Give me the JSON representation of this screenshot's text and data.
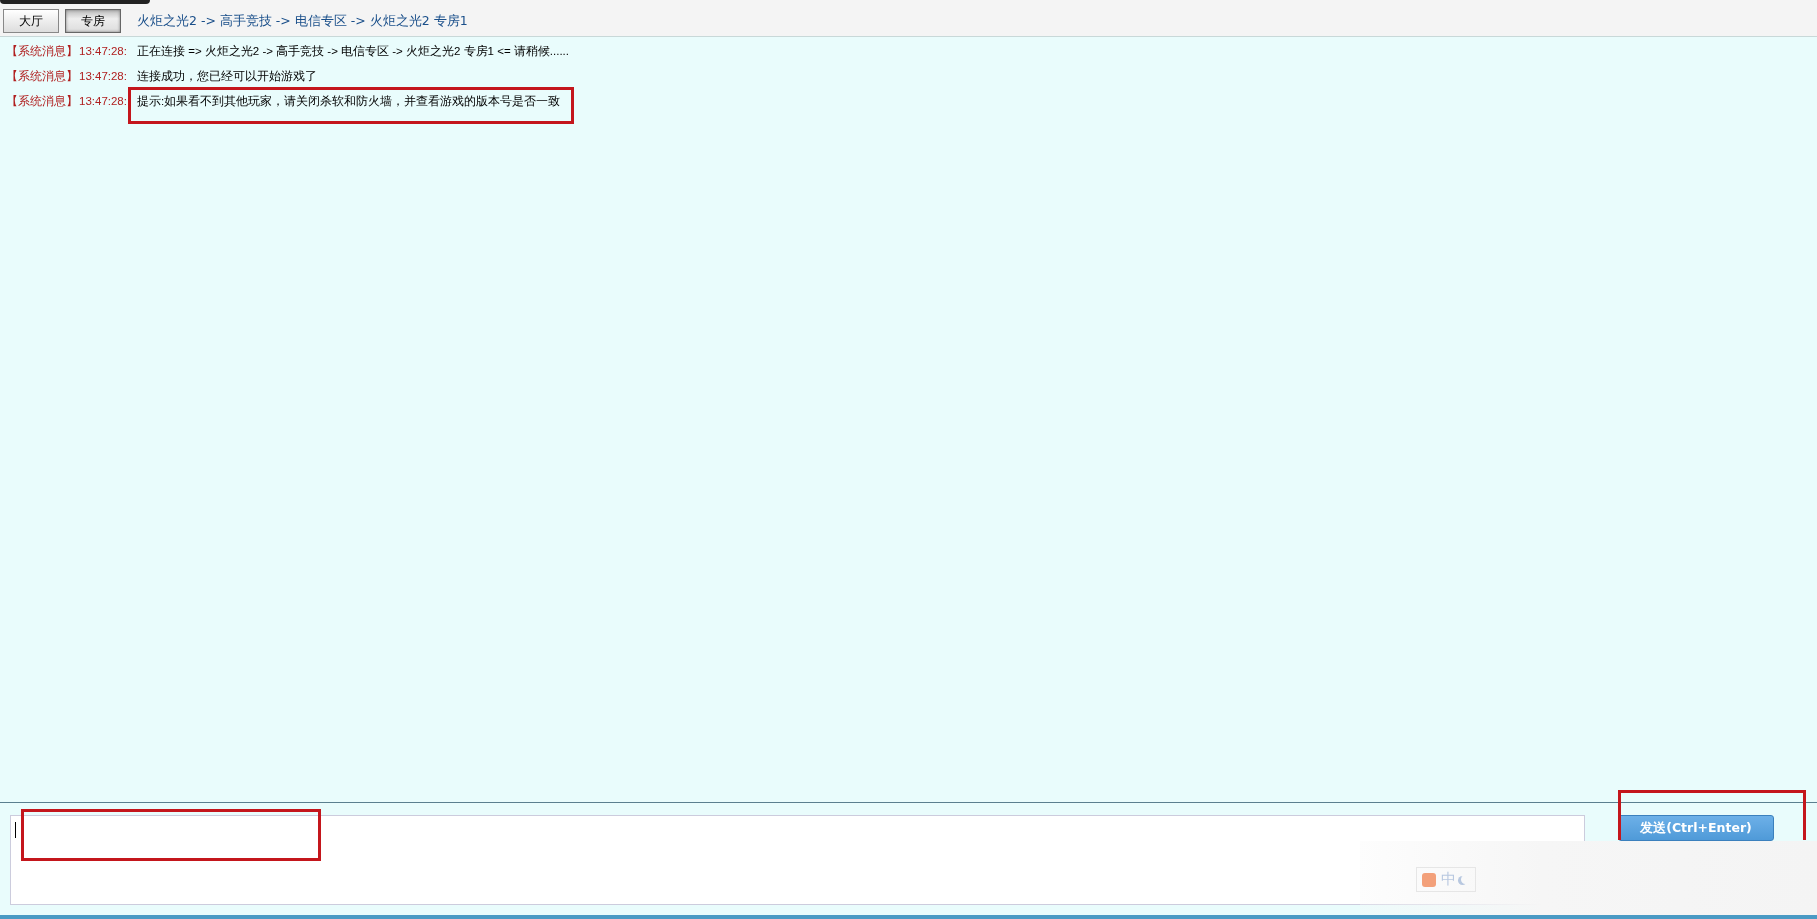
{
  "tabs": [
    {
      "label": "大厅",
      "selected": false
    },
    {
      "label": "专房",
      "selected": true
    }
  ],
  "breadcrumb": "火炬之光2 -> 高手竞技 -> 电信专区 -> 火炬之光2 专房1",
  "messages": [
    {
      "source": "【系统消息】",
      "time": "13:47:28:",
      "text": "正在连接 => 火炬之光2 -> 高手竞技 -> 电信专区 -> 火炬之光2 专房1 <= 请稍候......"
    },
    {
      "source": "【系统消息】",
      "time": "13:47:28:",
      "text": "连接成功，您已经可以开始游戏了"
    },
    {
      "source": "【系统消息】",
      "time": "13:47:28:",
      "text": "提示:如果看不到其他玩家，请关闭杀软和防火墙，并查看游戏的版本号是否一致"
    }
  ],
  "send_button": "发送(Ctrl+Enter)",
  "ime_toolbar": {
    "label": "中"
  }
}
